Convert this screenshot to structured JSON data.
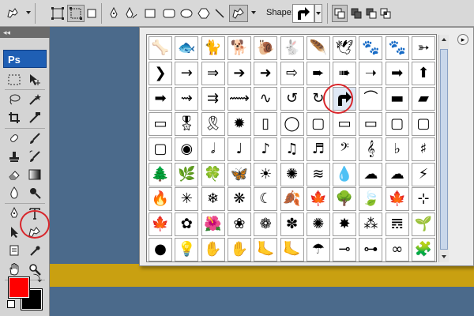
{
  "options_bar": {
    "shape_label": "Shape:",
    "tools": [
      "tool-preset-icon",
      "shape-layers-icon",
      "paths-icon",
      "fill-pixels-icon",
      "pen-icon",
      "freeform-pen-icon",
      "rectangle-icon",
      "rounded-rectangle-icon",
      "ellipse-icon",
      "polygon-icon",
      "line-icon",
      "custom-shape-icon"
    ],
    "shape_mode_buttons": [
      "new-layer-icon",
      "add-to-shape-icon",
      "subtract-shape-icon",
      "intersect-shape-icon"
    ]
  },
  "toolbox": {
    "logo": "Ps",
    "collapse_label": "◂◂",
    "colors": {
      "foreground": "#ff0000",
      "background": "#000000"
    }
  },
  "shape_picker": {
    "rows": [
      [
        "🦴",
        "🐟",
        "🐈",
        "🐕",
        "🐌",
        "🐇",
        "🪶",
        "🕊",
        "🐾",
        "🐾",
        "➳"
      ],
      [
        "❯",
        "→",
        "⇒",
        "➔",
        "➜",
        "⇨",
        "➨",
        "➠",
        "➝",
        "➡",
        "⬆"
      ],
      [
        "➡",
        "⇝",
        "⇉",
        "⟿",
        "∿",
        "↺",
        "↻",
        "↱",
        "⌒",
        "▬",
        "▰"
      ],
      [
        "▭",
        "🎖",
        "🎗",
        "✹",
        "▯",
        "◯",
        "▢",
        "▭",
        "▭",
        "▢",
        "▢"
      ],
      [
        "▢",
        "◉",
        "𝅗𝅥",
        "♩",
        "♪",
        "♫",
        "♬",
        "𝄢",
        "𝄞",
        "♭",
        "♯"
      ],
      [
        "🌲",
        "🌿",
        "🍀",
        "🦋",
        "☀",
        "✺",
        "≋",
        "💧",
        "☁",
        "☁",
        "⚡"
      ],
      [
        "🔥",
        "✳",
        "❄",
        "❋",
        "☾",
        "🍂",
        "🍁",
        "🌳",
        "🍃",
        "🍁",
        "⊹"
      ],
      [
        "🍁",
        "✿",
        "🌺",
        "❀",
        "❁",
        "✽",
        "✺",
        "✸",
        "⁂",
        "𝌋",
        "🌱"
      ],
      [
        "●",
        "💡",
        "✋",
        "✋",
        "🦶",
        "🦶",
        "☂",
        "⊸",
        "⊶",
        "∞",
        "🧩"
      ]
    ],
    "selected_shape": "arrow-turn-right",
    "menu_button": "▸"
  },
  "canvas": {
    "background": "#4b6a8b",
    "band_color": "#c9a011"
  }
}
